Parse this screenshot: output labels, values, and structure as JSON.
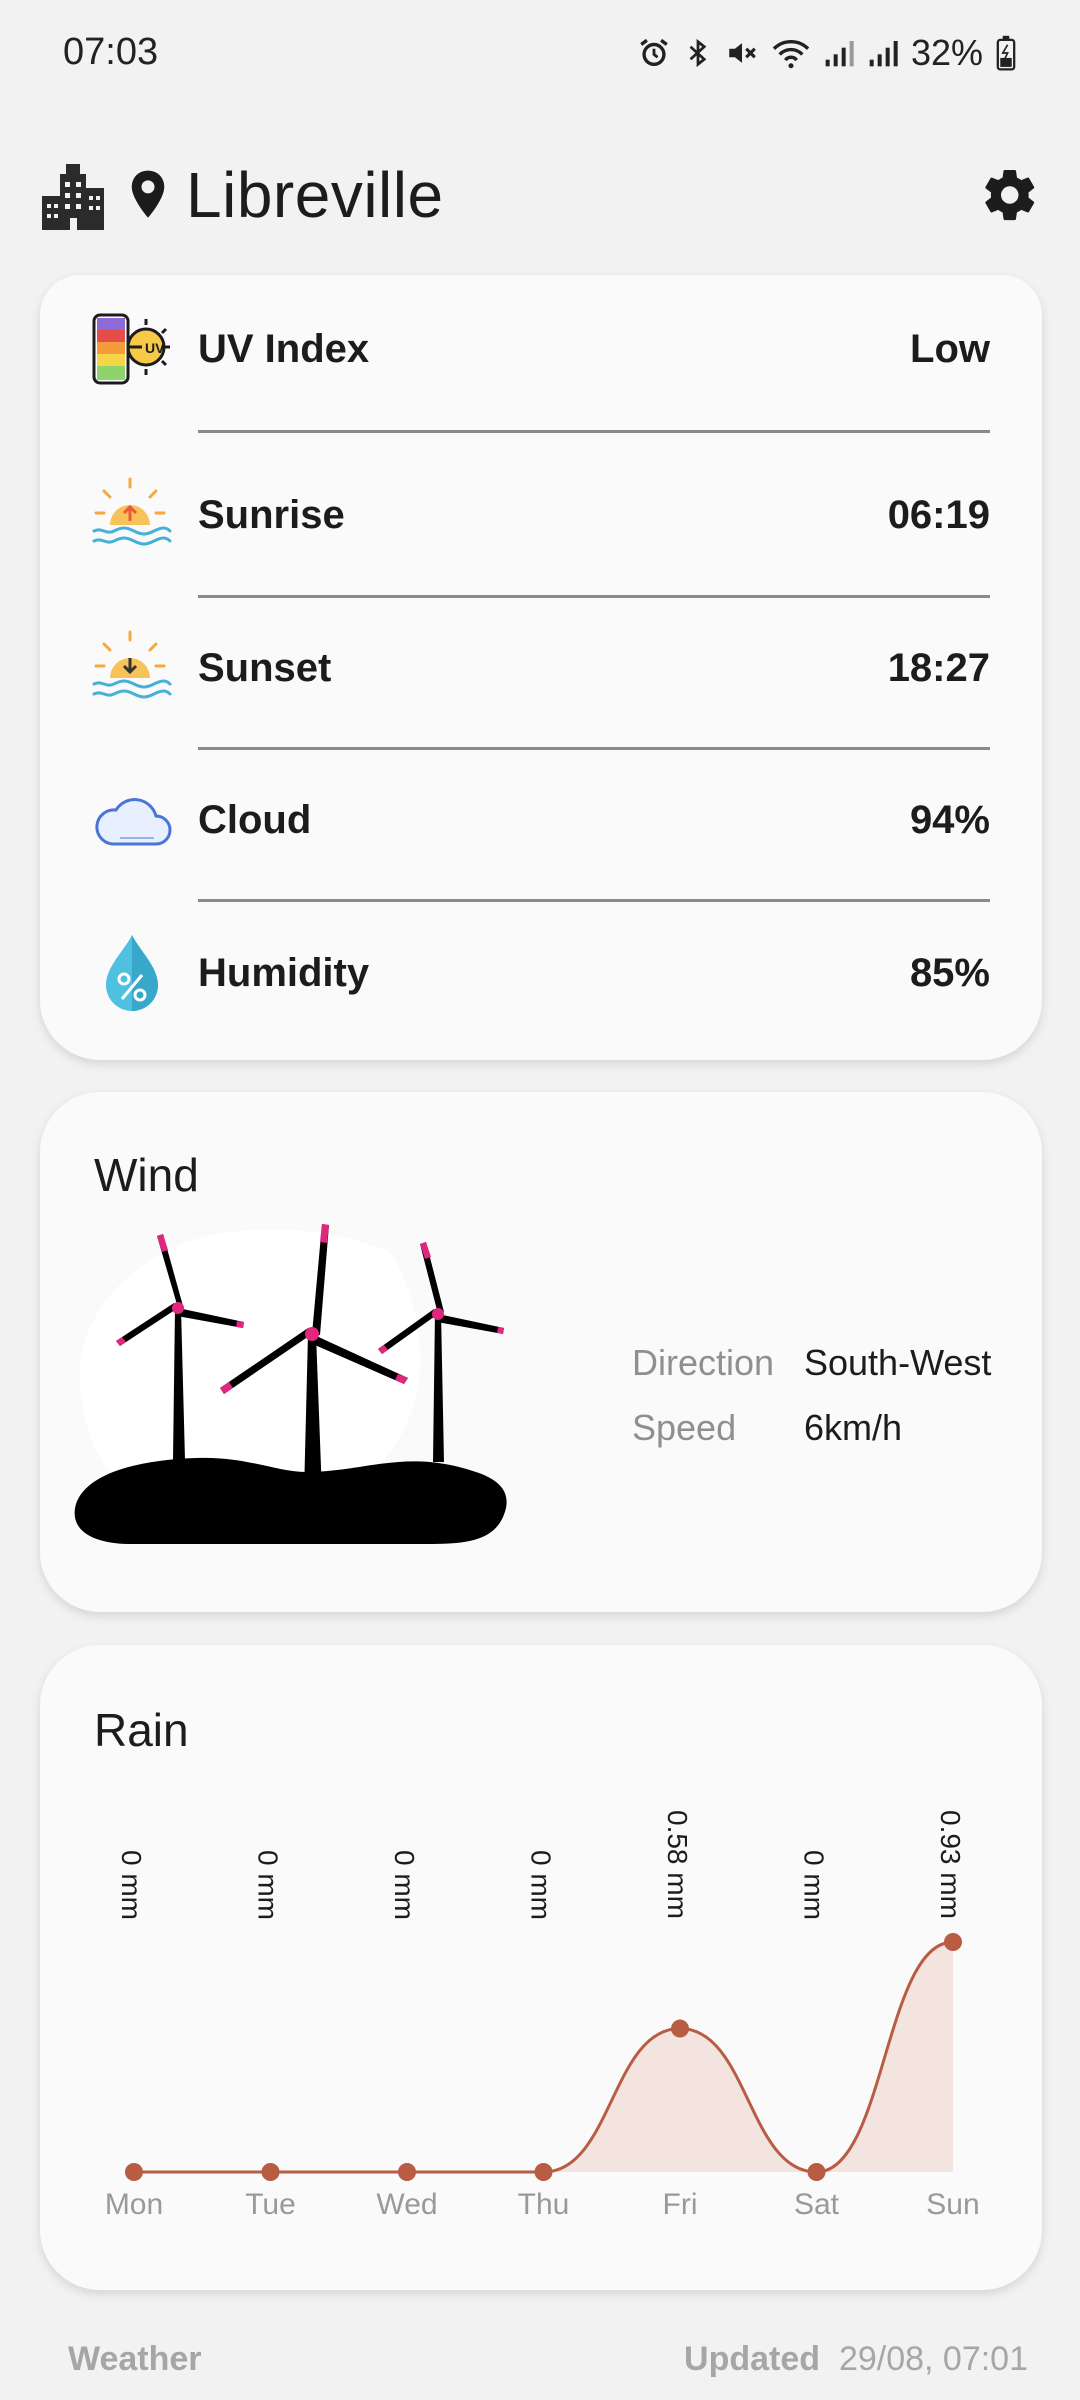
{
  "status_bar": {
    "time": "07:03",
    "battery": "32%"
  },
  "header": {
    "city": "Libreville"
  },
  "details": [
    {
      "label": "UV Index",
      "value": "Low",
      "icon": "uv-index-icon"
    },
    {
      "label": "Sunrise",
      "value": "06:19",
      "icon": "sunrise-icon"
    },
    {
      "label": "Sunset",
      "value": "18:27",
      "icon": "sunset-icon"
    },
    {
      "label": "Cloud",
      "value": "94%",
      "icon": "cloud-icon"
    },
    {
      "label": "Humidity",
      "value": "85%",
      "icon": "humidity-icon"
    }
  ],
  "wind": {
    "title": "Wind",
    "direction_label": "Direction",
    "direction_value": "South-West",
    "speed_label": "Speed",
    "speed_value": "6km/h"
  },
  "rain": {
    "title": "Rain"
  },
  "chart_data": {
    "type": "area",
    "categories": [
      "Mon",
      "Tue",
      "Wed",
      "Thu",
      "Fri",
      "Sat",
      "Sun"
    ],
    "values": [
      0,
      0,
      0,
      0,
      0.58,
      0,
      0.93
    ],
    "data_labels": [
      "0 mm",
      "0 mm",
      "0 mm",
      "0 mm",
      "0.58 mm",
      "0 mm",
      "0.93 mm"
    ],
    "unit": "mm",
    "color": "#b85c44",
    "fill_color": "#f3e4df"
  },
  "footer": {
    "app_name": "Weather",
    "updated_label": "Updated",
    "updated_value": "29/08, 07:01"
  }
}
